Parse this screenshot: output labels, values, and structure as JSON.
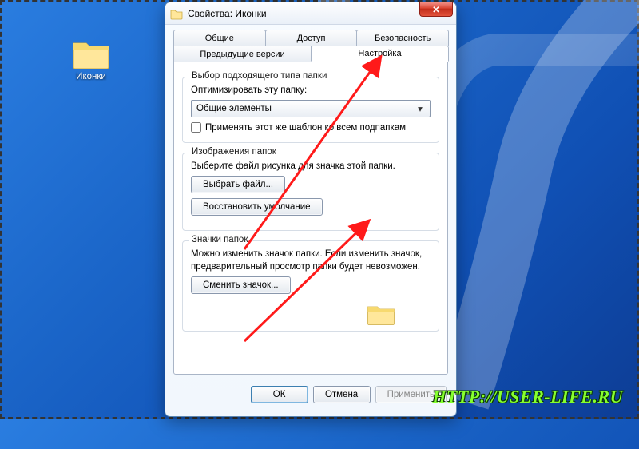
{
  "desktop": {
    "icon_label": "Иконки"
  },
  "window": {
    "title": "Свойства: Иконки",
    "close_symbol": "✕"
  },
  "tabs": {
    "row1": [
      "Общие",
      "Доступ",
      "Безопасность"
    ],
    "row2": [
      "Предыдущие версии",
      "Настройка"
    ],
    "active": "Настройка"
  },
  "group1": {
    "title": "Выбор подходящего типа папки",
    "optimize_label": "Оптимизировать эту папку:",
    "combo_value": "Общие элементы",
    "apply_subfolders": "Применять этот же шаблон ко всем подпапкам"
  },
  "group2": {
    "title": "Изображения папок",
    "desc": "Выберите файл рисунка для значка этой папки.",
    "choose_file": "Выбрать файл...",
    "restore_default": "Восстановить умолчание"
  },
  "group3": {
    "title": "Значки папок",
    "desc1": "Можно изменить значок папки. Если изменить значок,",
    "desc2": "предварительный просмотр папки будет невозможен.",
    "change_icon": "Сменить значок..."
  },
  "buttons": {
    "ok": "ОК",
    "cancel": "Отмена",
    "apply": "Применить"
  },
  "watermark": "HTTP://USER-LIFE.RU"
}
